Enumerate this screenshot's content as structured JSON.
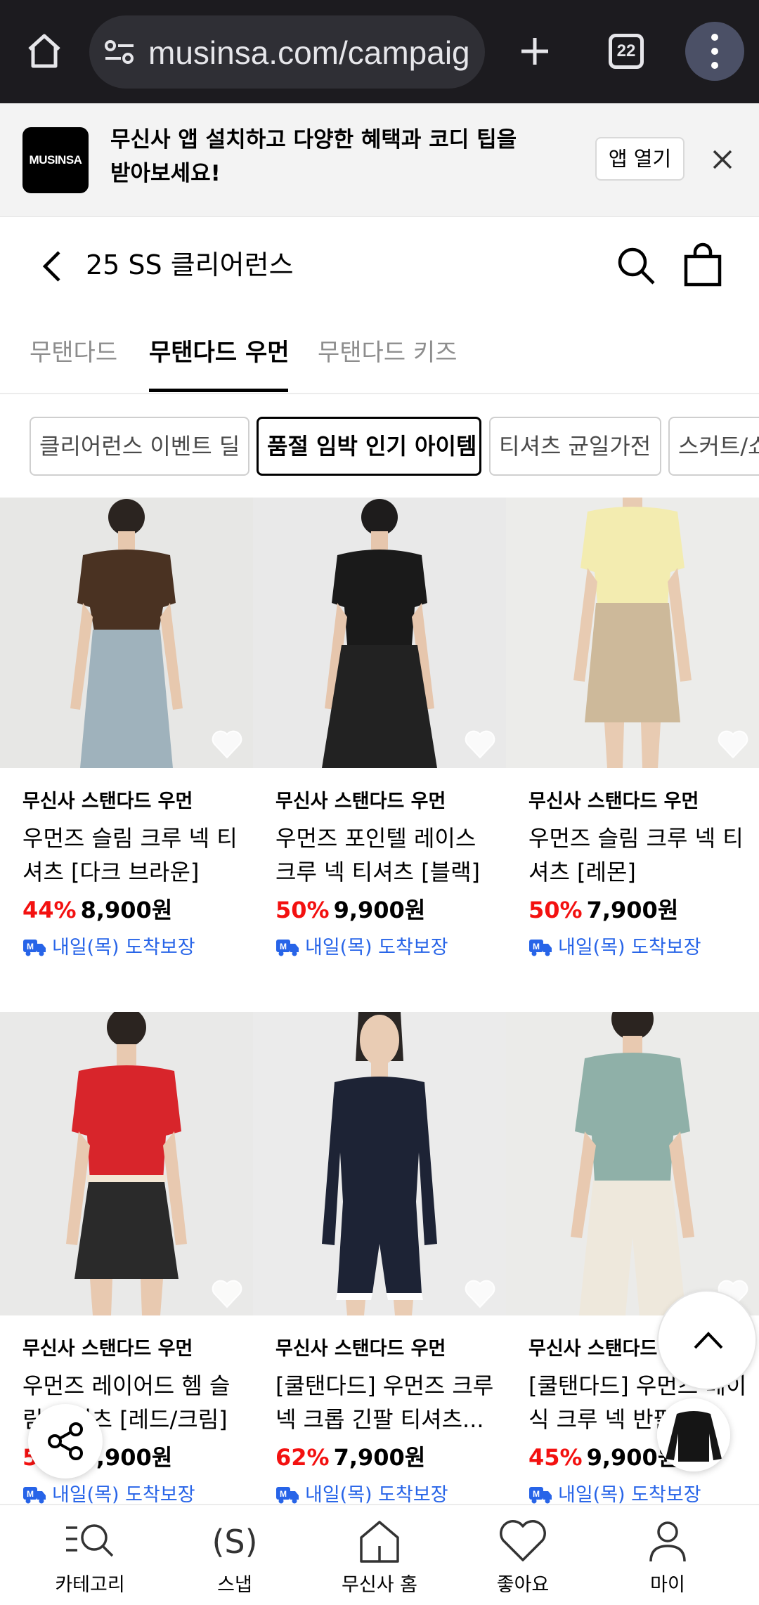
{
  "browser": {
    "url": "musinsa.com/campaign",
    "tab_count": "22"
  },
  "banner": {
    "logo_text": "MUSINSA",
    "message_line1": "무신사 앱 설치하고 다양한 혜택과 코디 팁을",
    "message_line2": "받아보세요!",
    "open_label": "앱 열기"
  },
  "header": {
    "title": "25 SS 클리어런스"
  },
  "tabs": [
    {
      "label": "무탠다드"
    },
    {
      "label": "무탠다드 우먼"
    },
    {
      "label": "무탠다드 키즈"
    }
  ],
  "chips": [
    {
      "label": "클리어런스 이벤트 딜"
    },
    {
      "label": "품절 임박 인기 아이템"
    },
    {
      "label": "티셔츠 균일가전"
    },
    {
      "label": "스커트/쇼츠"
    }
  ],
  "products": [
    {
      "brand": "무신사 스탠다드 우먼",
      "name": "우먼즈 슬림 크루 넥 티셔츠 [다크 브라운]",
      "discount": "44%",
      "price": "8,900원",
      "delivery": "내일(목) 도착보장",
      "top_color": "#4a3222",
      "bottom_color": "#9fb2bc"
    },
    {
      "brand": "무신사 스탠다드 우먼",
      "name": "우먼즈 포인텔 레이스 크루 넥 티셔츠 [블랙]",
      "discount": "50%",
      "price": "9,900원",
      "delivery": "내일(목) 도착보장",
      "top_color": "#1a1a1a",
      "bottom_color": "#222222"
    },
    {
      "brand": "무신사 스탠다드 우먼",
      "name": "우먼즈 슬림 크루 넥 티셔츠 [레몬]",
      "discount": "50%",
      "price": "7,900원",
      "delivery": "내일(목) 도착보장",
      "top_color": "#f3ecb0",
      "bottom_color": "#cdb99a"
    },
    {
      "brand": "무신사 스탠다드 우먼",
      "name": "우먼즈 레이어드 헴 슬림 티셔츠 [레드/크림]",
      "discount": "50%",
      "price": "9,900원",
      "delivery": "내일(목) 도착보장",
      "top_color": "#d8252b",
      "bottom_color": "#2a2a2a"
    },
    {
      "brand": "무신사 스탠다드 우먼",
      "name": "[쿨탠다드] 우먼즈 크루 넥 크롭 긴팔 티셔츠...",
      "discount": "62%",
      "price": "7,900원",
      "delivery": "내일(목) 도착보장",
      "top_color": "#1d2335",
      "bottom_color": "#1d2335"
    },
    {
      "brand": "무신사 스탠다드 우먼",
      "name": "[쿨탠다드] 우먼즈 베이식 크루 넥 반팔 티...",
      "discount": "45%",
      "price": "9,900원",
      "delivery": "내일(목) 도착보장",
      "top_color": "#8fb0a8",
      "bottom_color": "#eee8dc"
    }
  ],
  "bottom_nav": [
    {
      "label": "카테고리",
      "icon": "category-search-icon"
    },
    {
      "label": "스냅",
      "icon": "snap-icon"
    },
    {
      "label": "무신사 홈",
      "icon": "home-icon"
    },
    {
      "label": "좋아요",
      "icon": "heart-icon"
    },
    {
      "label": "마이",
      "icon": "person-icon"
    }
  ],
  "snap_icon_text": "(S)",
  "colors": {
    "discount": "#f31110",
    "delivery": "#2764e8",
    "chrome_bg": "#1c1b1f"
  }
}
